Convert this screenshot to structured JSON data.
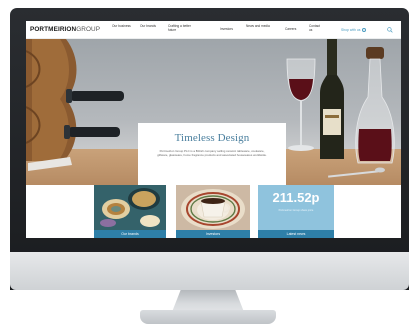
{
  "site": {
    "logo_bold": "PORTMEIRION",
    "logo_light": "GROUP"
  },
  "nav": {
    "items": [
      {
        "label": "Our business"
      },
      {
        "label": "Our brands"
      },
      {
        "label": "Crafting a better future"
      },
      {
        "label": "Investors"
      },
      {
        "label": "News and media"
      },
      {
        "label": "Careers"
      },
      {
        "label": "Contact us"
      }
    ],
    "shop_label": "Shop with us",
    "search_icon": "search-icon"
  },
  "hero": {
    "title": "Timeless Design",
    "text": "Portmeirion Group PLC is a British company selling ceramic tableware, cookware, giftware, glassware, home fragrance products and associated housewares worldwide."
  },
  "tiles": [
    {
      "label": "Our brands"
    },
    {
      "label": "Investors"
    },
    {
      "label": "Latest news",
      "price": "211.52p",
      "note": "Portmeirion Group share price"
    }
  ],
  "colors": {
    "accent": "#4a7f9e",
    "tile_label": "#2e7fa8",
    "share_tile": "#8fc3dd"
  }
}
